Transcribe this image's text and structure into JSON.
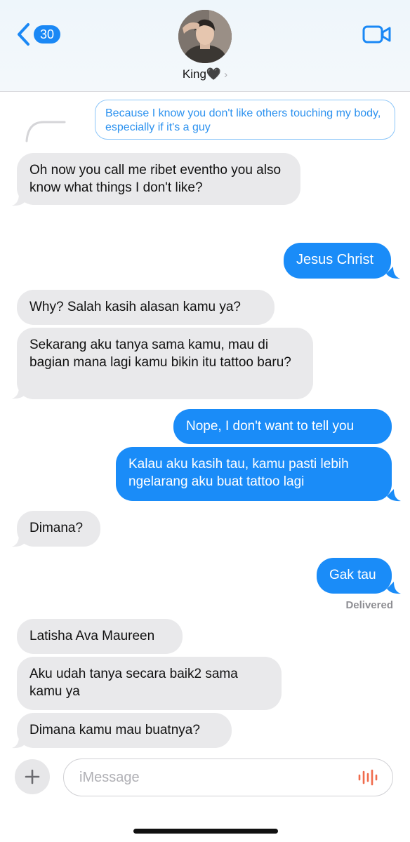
{
  "header": {
    "unread_count": "30",
    "contact_name": "King🖤",
    "icons": {
      "back": "chevron-left-icon",
      "video": "video-camera-icon",
      "chevron": "chevron-right-icon"
    }
  },
  "thread": {
    "reply_quote": "Because I know you don't like others touching my body, especially if it's a guy",
    "messages": [
      {
        "from": "them",
        "text": "Oh now you call me ribet eventho you also know what things I don't like?"
      },
      {
        "from": "me",
        "text": "Jesus Christ"
      },
      {
        "from": "them",
        "text": "Why? Salah kasih alasan kamu ya?"
      },
      {
        "from": "them",
        "text": "Sekarang aku tanya sama kamu, mau di bagian mana lagi kamu bikin itu tattoo baru?"
      },
      {
        "from": "me",
        "text": "Nope, I don't want to tell you"
      },
      {
        "from": "me",
        "text": "Kalau aku kasih tau, kamu pasti lebih ngelarang aku buat tattoo lagi"
      },
      {
        "from": "them",
        "text": "Dimana?"
      },
      {
        "from": "me",
        "text": "Gak tau"
      },
      {
        "from": "them",
        "text": "Latisha Ava Maureen"
      },
      {
        "from": "them",
        "text": "Aku udah tanya secara baik2 sama kamu ya"
      },
      {
        "from": "them",
        "text": "Dimana kamu mau buatnya?"
      }
    ],
    "delivered_label": "Delivered"
  },
  "composer": {
    "placeholder": "iMessage",
    "icons": {
      "plus": "plus-icon",
      "audio": "waveform-icon"
    }
  },
  "colors": {
    "accent": "#1a8cf8",
    "incoming_bubble": "#e9e9eb",
    "audio_icon": "#f06b4b"
  }
}
